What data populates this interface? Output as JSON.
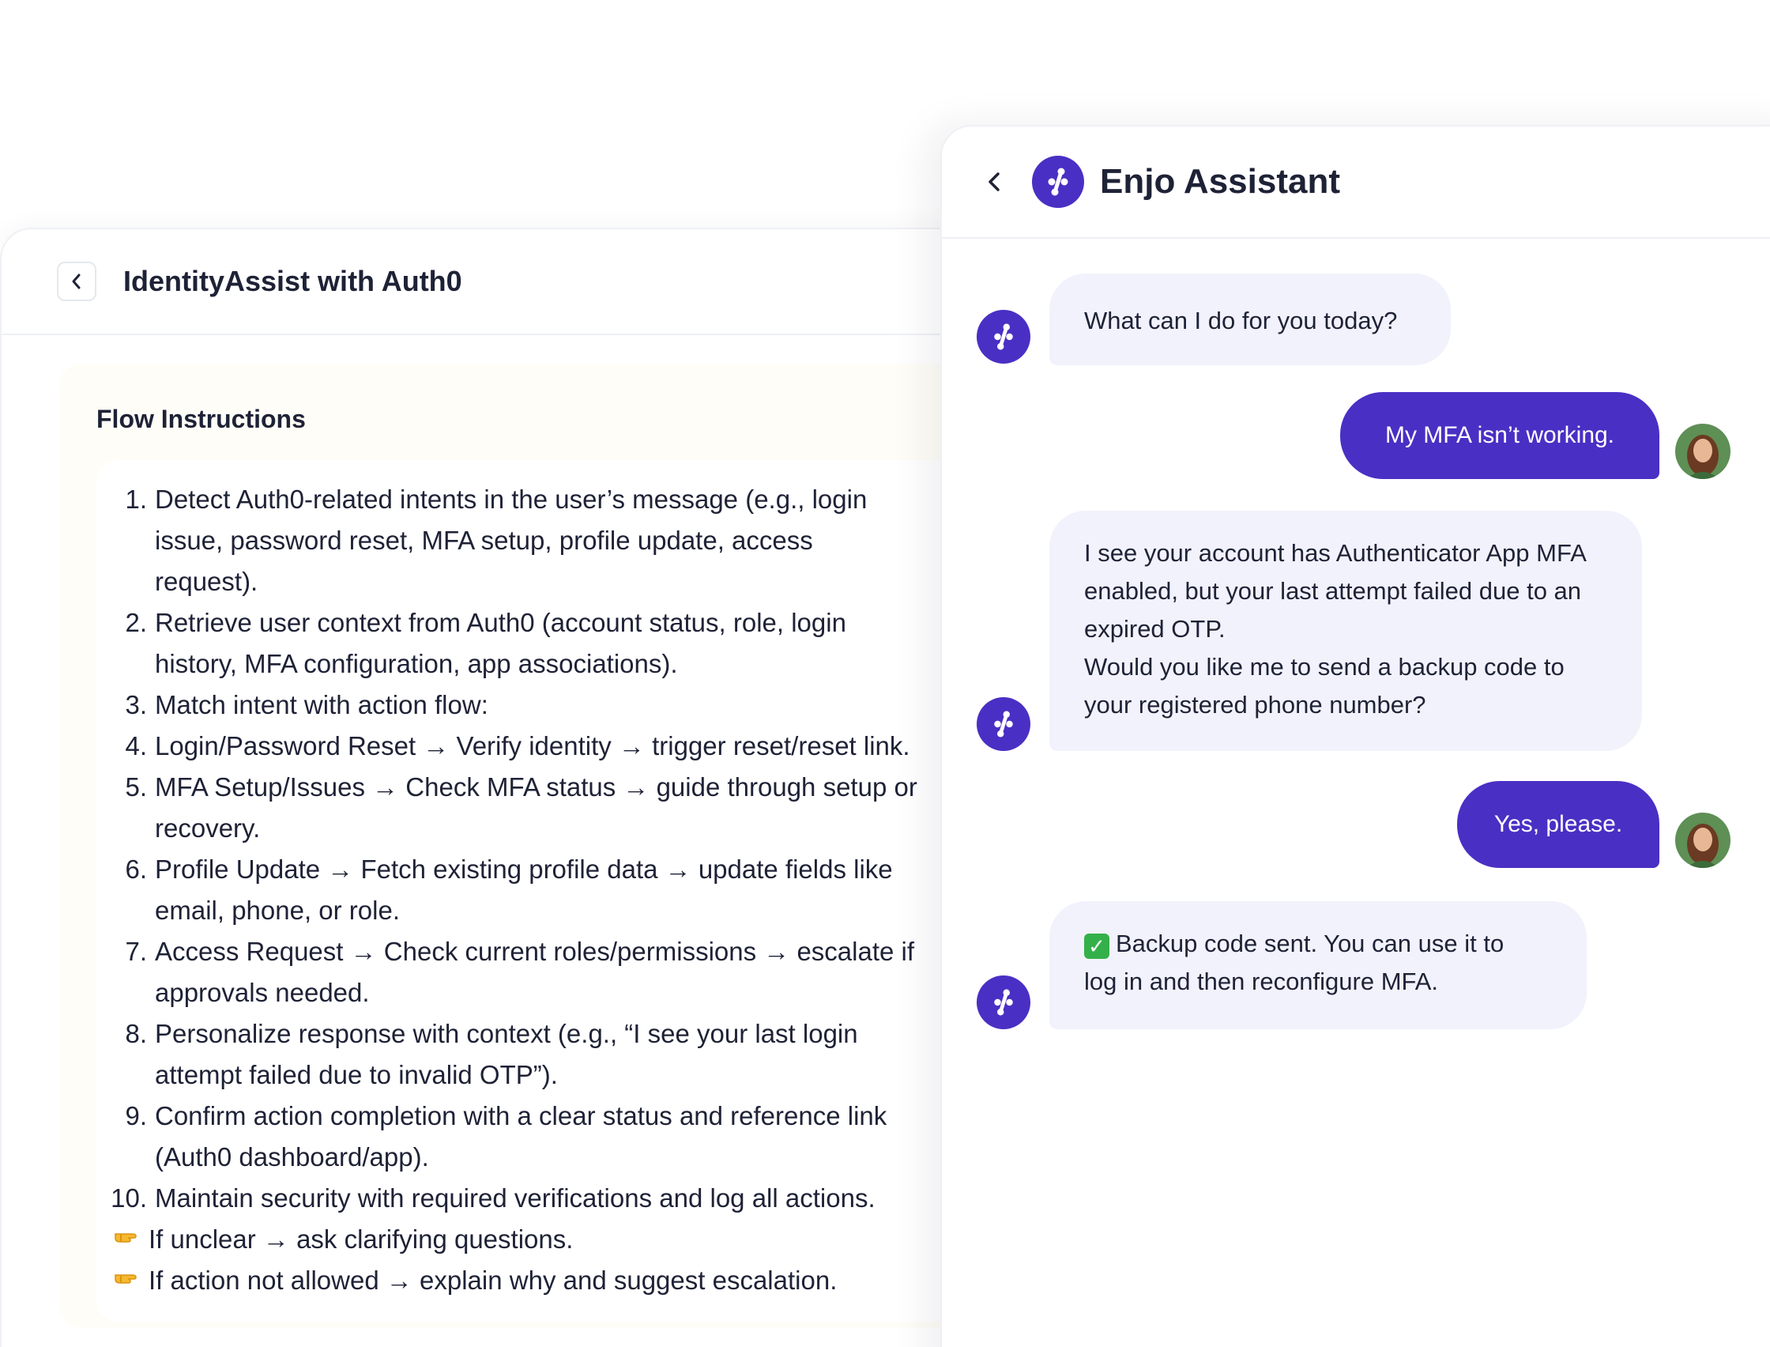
{
  "left_panel": {
    "title": "IdentityAssist with Auth0",
    "flow_title": "Flow Instructions",
    "steps": [
      "Detect Auth0-related intents in the user’s message (e.g., login",
      "issue, password reset, MFA setup, profile update, access",
      "request).",
      "Retrieve user context from Auth0 (account status, role, login",
      "history, MFA configuration, app associations).",
      "Match intent with action flow:",
      "Login/Password Reset → Verify identity → trigger reset/reset link.",
      "MFA Setup/Issues → Check MFA status → guide through setup or",
      "recovery.",
      "Profile Update → Fetch existing profile data → update fields like",
      "email, phone, or role.",
      "Access Request → Check current roles/permissions → escalate if",
      "approvals needed.",
      "Personalize response with context (e.g., “I see your last login",
      "attempt failed due to invalid OTP”).",
      "Confirm action completion with a clear status and reference link",
      "(Auth0 dashboard/app).",
      "Maintain security with required verifications and log all actions."
    ],
    "numbers": [
      "1.",
      "2.",
      "3.",
      "4.",
      "5.",
      "6.",
      "7.",
      "8.",
      "9.",
      "10."
    ],
    "notes": [
      "If unclear → ask clarifying questions.",
      "If action not allowed → explain why and suggest escalation."
    ],
    "note_icon": "pointing-hand-icon"
  },
  "chat": {
    "title": "Enjo Assistant",
    "messages": [
      {
        "from": "bot",
        "text": "What can I do for you today?"
      },
      {
        "from": "user",
        "text": "My MFA isn’t working."
      },
      {
        "from": "bot",
        "lines": [
          "I see your account has Authenticator App MFA",
          "enabled, but your last attempt failed due to an",
          "expired OTP.",
          "Would you like me to send a backup code to",
          "your registered phone number?"
        ]
      },
      {
        "from": "user",
        "text": "Yes, please."
      },
      {
        "from": "bot",
        "lines": [
          "Backup code sent. You can use it to",
          "log in and then reconfigure MFA."
        ],
        "icon": "check-mark-icon"
      }
    ]
  },
  "colors": {
    "accent": "#4a2fc4",
    "bot_bubble": "#f1f2fb",
    "flow_card_bg": "#fffdf7",
    "text": "#1e2236"
  }
}
